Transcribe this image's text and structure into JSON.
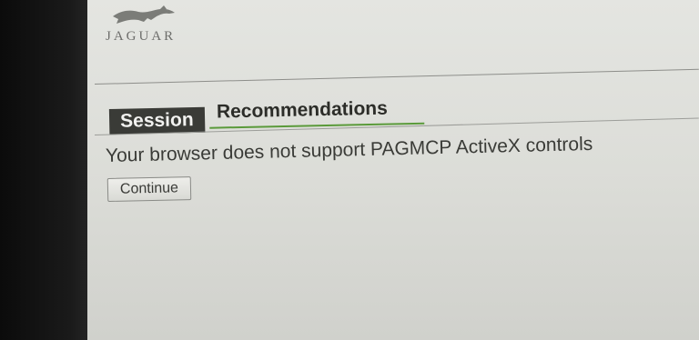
{
  "brand": {
    "logo_text": "JAGUAR",
    "logo_icon": "leaping-jaguar-icon"
  },
  "tabs": [
    {
      "label": "Session",
      "active": false
    },
    {
      "label": "Recommendations",
      "active": true
    }
  ],
  "content": {
    "message": "Your browser does not support PAGMCP ActiveX controls",
    "continue_label": "Continue"
  },
  "colors": {
    "screen_background": "#e4e5e1",
    "session_tab_background": "#3a3b37",
    "active_tab_underline": "#5a9a3a",
    "text": "#3a3b37"
  }
}
